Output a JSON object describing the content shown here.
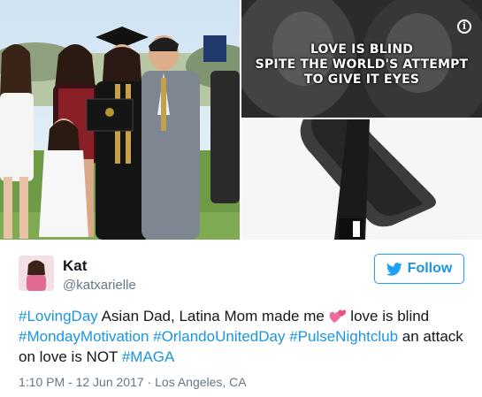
{
  "media": {
    "meme": {
      "line1": "LOVE IS BLIND",
      "line2": "SPITE THE WORLD'S ATTEMPT",
      "line3": "TO GIVE IT EYES"
    },
    "info_icon_glyph": "i"
  },
  "user": {
    "display_name": "Kat",
    "handle": "@katxarielle"
  },
  "follow_button": {
    "label": "Follow",
    "icon": "twitter-bird-icon"
  },
  "tweet": {
    "h1": "#LovingDay",
    "t1": " Asian Dad, Latina Mom made me ",
    "emoji": "two-hearts-emoji",
    "t2": " love is blind",
    "h2": "#MondayMotivation",
    "h3": "#OrlandoUnitedDay",
    "h4": "#PulseNightclub",
    "t3": " an attack on love is NOT ",
    "h5": "#MAGA"
  },
  "meta": {
    "time": "1:10 PM",
    "separator1": " - ",
    "date": "12 Jun 2017",
    "separator2": " · ",
    "location": "Los Angeles, CA"
  },
  "colors": {
    "link": "#1b95e0",
    "secondary_text": "#657786",
    "primary_text": "#14171a",
    "follow_border": "#1da1f2"
  }
}
